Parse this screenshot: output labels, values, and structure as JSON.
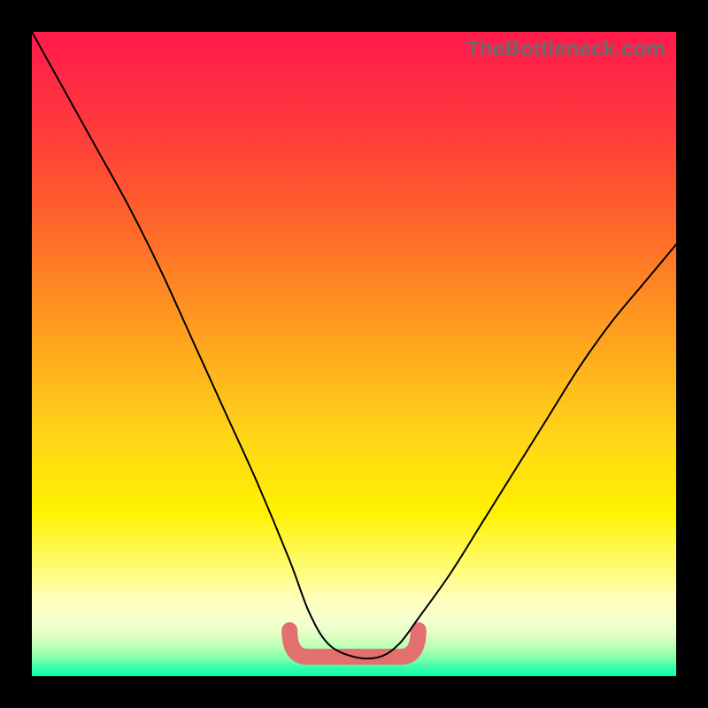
{
  "watermark": "TheBottleneck.com",
  "chart_data": {
    "type": "line",
    "title": "",
    "xlabel": "",
    "ylabel": "",
    "xlim": [
      0,
      100
    ],
    "ylim": [
      0,
      100
    ],
    "grid": false,
    "legend": false,
    "series": [
      {
        "name": "bottleneck-curve",
        "x": [
          0,
          5,
          10,
          15,
          20,
          25,
          30,
          35,
          40,
          43,
          46,
          50,
          54,
          57,
          60,
          65,
          70,
          75,
          80,
          85,
          90,
          95,
          100
        ],
        "y": [
          100,
          91,
          82,
          73,
          63,
          52,
          41,
          30,
          18,
          10,
          5,
          3,
          3,
          5,
          9,
          16,
          24,
          32,
          40,
          48,
          55,
          61,
          67
        ]
      }
    ],
    "flat_region": {
      "name": "optimal-range-highlight",
      "x_range": [
        40,
        60
      ],
      "y": 3
    },
    "background_gradient": {
      "top": "#ff1a4c",
      "mid": "#fff200",
      "bottom": "#09ffa6"
    }
  }
}
